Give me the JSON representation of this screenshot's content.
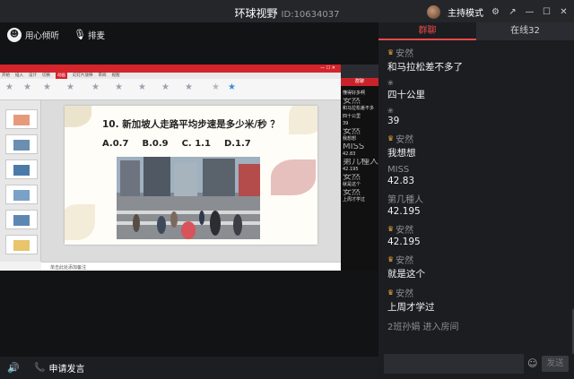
{
  "window": {
    "title": "环球视野",
    "room_id": "ID:10634037",
    "host_mode": "主持模式"
  },
  "toolbar": {
    "listen_label": "用心倾听",
    "mic_label": "排麦"
  },
  "slide": {
    "question": "10. 新加坡人走路平均步速是多少米/秒 ？",
    "options": [
      "A.0.7",
      "B.0.9",
      "C. 1.1",
      "D.1.7"
    ],
    "note": "单击此处添加备注"
  },
  "ppt": {
    "tabs": [
      "开始",
      "插入",
      "设计",
      "切换",
      "动画",
      "幻灯片放映",
      "审阅",
      "视图"
    ],
    "active_tab": "动画"
  },
  "mini_chat": {
    "tab": "群聊",
    "lines": [
      {
        "t": "懂得好多啊",
        "nick": false
      },
      {
        "t": "安然",
        "nick": true
      },
      {
        "t": "和马拉松差不多",
        "nick": false
      },
      {
        "t": "四十公里",
        "nick": false
      },
      {
        "t": "39",
        "nick": false
      },
      {
        "t": "安然",
        "nick": true
      },
      {
        "t": "我想想",
        "nick": false
      },
      {
        "t": "MISS",
        "nick": true
      },
      {
        "t": "42.83",
        "nick": false
      },
      {
        "t": "第几種人",
        "nick": true
      },
      {
        "t": "42.195",
        "nick": false
      },
      {
        "t": "安然",
        "nick": true
      },
      {
        "t": "就是这个",
        "nick": false
      },
      {
        "t": "安然",
        "nick": true
      },
      {
        "t": "上周才学过",
        "nick": false
      }
    ]
  },
  "bottom": {
    "apply_label": "申请发言"
  },
  "chat": {
    "tab_chat": "群聊",
    "tab_online": "在线32",
    "messages": [
      {
        "nick": "安然",
        "badge": "gold",
        "text": "和马拉松差不多了"
      },
      {
        "nick": "",
        "badge": "grey",
        "text": "四十公里"
      },
      {
        "nick": "",
        "badge": "grey",
        "text": "39"
      },
      {
        "nick": "安然",
        "badge": "gold",
        "text": "我想想"
      },
      {
        "nick": "MISS",
        "badge": "",
        "text": "42.83"
      },
      {
        "nick": "第几種人",
        "badge": "",
        "text": "42.195"
      },
      {
        "nick": "安然",
        "badge": "gold",
        "text": "42.195"
      },
      {
        "nick": "安然",
        "badge": "gold",
        "text": "就是这个"
      },
      {
        "nick": "安然",
        "badge": "gold",
        "text": "上周才学过"
      }
    ],
    "join_notice": "2班孙娟 进入房间",
    "input_placeholder": "",
    "send_label": "发送"
  }
}
